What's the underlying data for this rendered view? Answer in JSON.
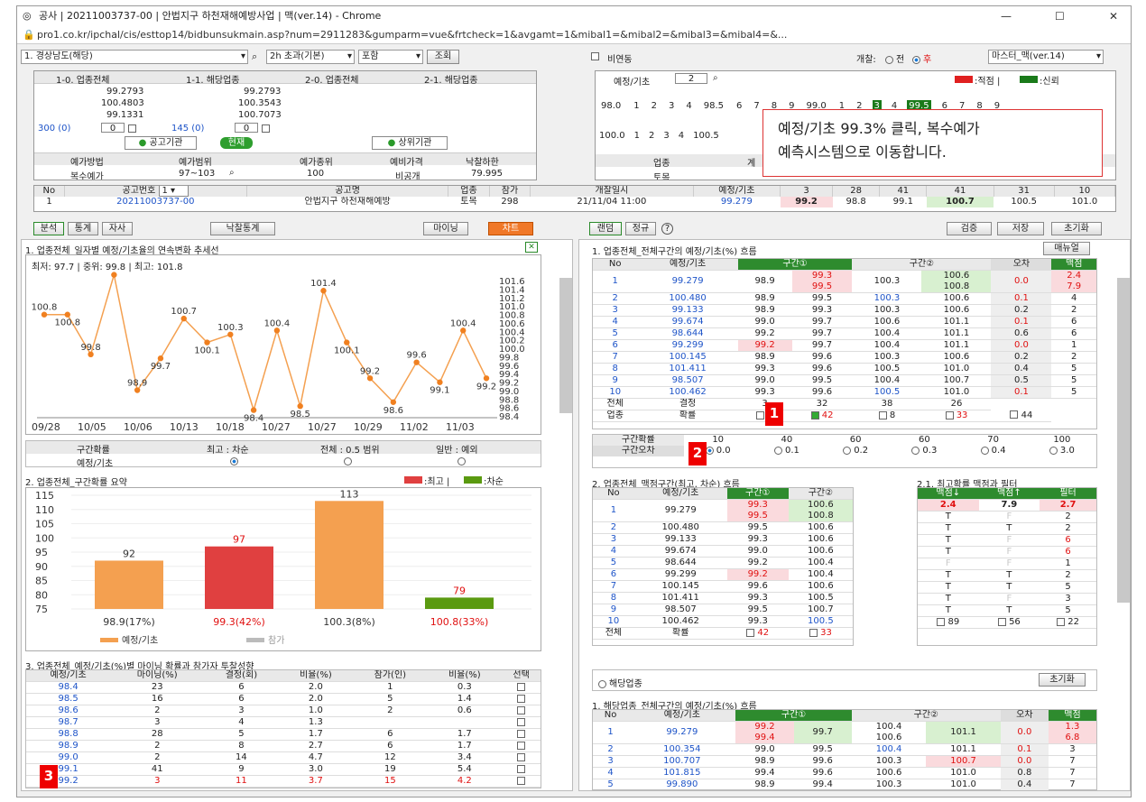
{
  "window": {
    "title": "공사 | 20211003737-00 | 안법지구 하천재해예방사업 | 맥(ver.14) - Chrome",
    "url": "pro1.co.kr/ipchal/cis/esttop14/bidbunsukmain.asp?num=2911283&gumparm=vue&frtcheck=1&avgamt=1&mibal1=&mibal2=&mibal3=&mibal4=&..."
  },
  "toolbar": {
    "region": "1. 경상남도(해당)",
    "period": "2h 초과(기본)",
    "type": "포함",
    "search": "조회",
    "nonlink": "비연동",
    "gaechal_label": "개찰:",
    "opt_all": "전",
    "opt_after": "후",
    "master": "마스터_맥(ver.14)"
  },
  "top_left": {
    "headers": [
      "1-0. 업종전체",
      "1-1. 해당업종",
      "2-0. 업종전체",
      "2-1. 해당업종"
    ],
    "col1": [
      "99.2793",
      "100.4803",
      "99.1331"
    ],
    "col2": [
      "99.2793",
      "100.3543",
      "100.7073"
    ],
    "cnt1": "300 (0)",
    "cnt2": "145 (0)",
    "in1": "0",
    "in2": "0",
    "btn_agency": "공고기관",
    "btn_now": "현재",
    "btn_upper": "상위기관"
  },
  "price_info": {
    "headers": [
      "예가방법",
      "예가범위",
      "예가종위",
      "예비가격",
      "낙찰하한"
    ],
    "values": [
      "복수예가",
      "97~103",
      "100",
      "비공개",
      "79.995"
    ]
  },
  "yejeong": {
    "label": "예정/기초",
    "val": "2",
    "legend1": ":적점 |",
    "legend2": ":신뢰",
    "row1": [
      "98.0",
      "1",
      "2",
      "3",
      "4",
      "98.5",
      "6",
      "7",
      "8",
      "9",
      "99.0",
      "1",
      "2",
      "3",
      "4",
      "99.5",
      "6",
      "7",
      "8",
      "9"
    ],
    "row2": [
      "100.0",
      "1",
      "2",
      "3",
      "4",
      "100.5"
    ],
    "biz_label": "업종",
    "biz_val": "토목",
    "gye": "계"
  },
  "callout": {
    "line1": "예정/기초 99.3% 클릭, 복수예가",
    "line2": "예측시스템으로 이동합니다."
  },
  "notice": {
    "headers": [
      "No",
      "공고번호",
      "공고명",
      "업종",
      "참가",
      "개찰일시",
      "예정/기초",
      "3",
      "28",
      "41",
      "41",
      "31",
      "10"
    ],
    "combo": "1",
    "row": [
      "1",
      "20211003737-00",
      "안법지구 하천재해예방",
      "토목",
      "298",
      "21/11/04 11:00",
      "99.279",
      "99.2",
      "98.8",
      "99.1",
      "100.7",
      "100.5",
      "101.0"
    ]
  },
  "left_tabs": {
    "t1": "분석",
    "t2": "통계",
    "t3": "자사",
    "t4": "낙찰통계",
    "t5": "마이닝",
    "t6": "차트"
  },
  "right_tabs": {
    "t1": "랜덤",
    "t2": "정규",
    "t3": "?",
    "b1": "검증",
    "b2": "저장",
    "b3": "초기화"
  },
  "chart1": {
    "title": "1. 업종전체_일자별 예정/기초율의 연속변화 추세선",
    "stats": "최저: 97.7 | 중위: 99.8 | 최고: 101.8"
  },
  "chart_data": [
    {
      "type": "line",
      "title": "1. 업종전체_일자별 예정/기초율의 연속변화 추세선",
      "y": [
        100.8,
        100.8,
        99.8,
        101.8,
        98.9,
        99.7,
        100.7,
        100.1,
        100.3,
        98.4,
        100.4,
        98.5,
        101.4,
        100.1,
        99.2,
        98.6,
        99.6,
        99.1,
        100.4,
        99.2
      ],
      "point_labels": [
        "100.8",
        "100.8",
        "99.8",
        "",
        "98.9",
        "99.7",
        "100.7",
        "100.1",
        "100.3",
        "98.4",
        "100.4",
        "98.5",
        "101.4",
        "100.1",
        "99.2",
        "98.6",
        "99.6",
        "99.1",
        "100.4",
        "99.2"
      ],
      "xticks": [
        "09/28",
        "10/05",
        "10/06",
        "10/13",
        "10/18",
        "10/27",
        "10/27",
        "10/29",
        "11/02",
        "11/03"
      ],
      "yticks": [
        "101.6",
        "101.4",
        "101.2",
        "101.0",
        "100.8",
        "100.6",
        "100.4",
        "100.2",
        "100.0",
        "99.8",
        "99.6",
        "99.4",
        "99.2",
        "99.0",
        "98.8",
        "98.6",
        "98.4"
      ],
      "ylim": [
        98.3,
        101.7
      ]
    },
    {
      "type": "bar",
      "title": "2. 업종전체_구간확률 요약",
      "categories": [
        "98.9(17%)",
        "99.3(42%)",
        "100.3(8%)",
        "100.8(33%)"
      ],
      "values": [
        92,
        97,
        113,
        79
      ],
      "colors": [
        "#f4a050",
        "#e04040",
        "#f4a050",
        "#5a9a10"
      ],
      "yticks": [
        "115",
        "110",
        "105",
        "100",
        "95",
        "90",
        "85",
        "80",
        "75"
      ],
      "ylim": [
        75,
        115
      ],
      "legend_top": [
        ":최고 |",
        ":차순"
      ],
      "legend_bottom": [
        "예정/기초",
        "참가"
      ]
    }
  ],
  "prob_row": {
    "h1": "구간확률",
    "h2": "최고 : 차순",
    "h3": "전체 : 0.5 범위",
    "h4": "일반 : 예외",
    "label": "예정/기초"
  },
  "table3": {
    "title": "3. 업종전체_예정/기초(%)별 마이닝 확률과 참가자 투찰성향",
    "headers": [
      "예정/기초",
      "마이닝(%)",
      "결정(회)",
      "비율(%)",
      "참가(인)",
      "비율(%)",
      "선택"
    ],
    "rows": [
      [
        "98.4",
        "23",
        "6",
        "2.0",
        "1",
        "0.3"
      ],
      [
        "98.5",
        "16",
        "6",
        "2.0",
        "5",
        "1.4"
      ],
      [
        "98.6",
        "2",
        "3",
        "1.0",
        "2",
        "0.6"
      ],
      [
        "98.7",
        "3",
        "4",
        "1.3",
        "",
        ""
      ],
      [
        "98.8",
        "28",
        "5",
        "1.7",
        "6",
        "1.7"
      ],
      [
        "98.9",
        "2",
        "8",
        "2.7",
        "6",
        "1.7"
      ],
      [
        "99.0",
        "2",
        "14",
        "4.7",
        "12",
        "3.4"
      ],
      [
        "99.1",
        "41",
        "9",
        "3.0",
        "19",
        "5.4"
      ],
      [
        "99.2",
        "3",
        "11",
        "3.7",
        "15",
        "4.2"
      ]
    ]
  },
  "rtable1": {
    "title": "1. 업종전체_전체구간의 예정/기초(%) 흐름",
    "menu": "매뉴얼",
    "headers": [
      "No",
      "예정/기초",
      "구간①",
      "구간②",
      "오차",
      "맥점"
    ],
    "rows": [
      [
        "1",
        "99.279",
        "98.9",
        "99.3\n99.5",
        "100.3",
        "100.6\n100.8",
        "0.0",
        "2.4\n7.9"
      ],
      [
        "2",
        "100.480",
        "98.9",
        "99.5",
        "100.3",
        "100.6",
        "0.1",
        "4"
      ],
      [
        "3",
        "99.133",
        "98.9",
        "99.3",
        "100.3",
        "100.6",
        "0.2",
        "2"
      ],
      [
        "4",
        "99.674",
        "99.0",
        "99.7",
        "100.6",
        "101.1",
        "0.1",
        "6"
      ],
      [
        "5",
        "98.644",
        "99.2",
        "99.7",
        "100.4",
        "101.1",
        "0.6",
        "6"
      ],
      [
        "6",
        "99.299",
        "99.2",
        "99.7",
        "100.4",
        "101.1",
        "0.0",
        "1"
      ],
      [
        "7",
        "100.145",
        "98.9",
        "99.6",
        "100.3",
        "100.6",
        "0.2",
        "2"
      ],
      [
        "8",
        "101.411",
        "99.3",
        "99.6",
        "100.5",
        "101.0",
        "0.4",
        "5"
      ],
      [
        "9",
        "98.507",
        "99.0",
        "99.5",
        "100.4",
        "100.7",
        "0.5",
        "5"
      ],
      [
        "10",
        "100.462",
        "99.3",
        "99.6",
        "100.5",
        "101.0",
        "0.1",
        "5"
      ]
    ],
    "total1": [
      "전체",
      "결정",
      "3",
      "32",
      "38",
      "26"
    ],
    "total2": [
      "업종",
      "확률",
      "1",
      "42",
      "8",
      "33",
      "44"
    ]
  },
  "gugan": {
    "label1": "구간확률",
    "vals": [
      "10",
      "40",
      "60",
      "60",
      "70",
      "100"
    ],
    "label2": "구간오차",
    "opts": [
      "0.0",
      "0.1",
      "0.2",
      "0.3",
      "0.4",
      "3.0"
    ]
  },
  "rtable2": {
    "title": "2. 업종전체_맥점구간(최고, 차순) 흐름",
    "headers": [
      "No",
      "예정/기초",
      "구간①",
      "구간②"
    ],
    "rows": [
      [
        "1",
        "99.279",
        "99.3\n99.5",
        "100.6\n100.8"
      ],
      [
        "2",
        "100.480",
        "99.5",
        "100.6"
      ],
      [
        "3",
        "99.133",
        "99.3",
        "100.6"
      ],
      [
        "4",
        "99.674",
        "99.0",
        "100.6"
      ],
      [
        "5",
        "98.644",
        "99.2",
        "100.4"
      ],
      [
        "6",
        "99.299",
        "99.2",
        "100.4"
      ],
      [
        "7",
        "100.145",
        "99.6",
        "100.6"
      ],
      [
        "8",
        "101.411",
        "99.3",
        "100.5"
      ],
      [
        "9",
        "98.507",
        "99.5",
        "100.7"
      ],
      [
        "10",
        "100.462",
        "99.3",
        "100.5"
      ]
    ],
    "total": [
      "전체",
      "확률",
      "42",
      "33"
    ]
  },
  "rtable21": {
    "title": "2.1. 최고확률 맥점과 필터",
    "headers": [
      "맥점↓",
      "맥점↑",
      "필터"
    ],
    "rows": [
      [
        "2.4",
        "7.9",
        "2.7"
      ],
      [
        "T",
        "F",
        "2"
      ],
      [
        "T",
        "T",
        "2"
      ],
      [
        "T",
        "F",
        "6"
      ],
      [
        "T",
        "F",
        "6"
      ],
      [
        "F",
        "F",
        "1"
      ],
      [
        "T",
        "T",
        "2"
      ],
      [
        "T",
        "T",
        "5"
      ],
      [
        "T",
        "F",
        "3"
      ],
      [
        "T",
        "T",
        "5"
      ]
    ],
    "total": [
      "89",
      "56",
      "22"
    ]
  },
  "rtable3": {
    "radio": "해당업종",
    "reset": "초기화",
    "title": "1. 해당업종_전체구간의 예정/기초(%) 흐름",
    "headers": [
      "No",
      "예정/기초",
      "구간①",
      "구간②",
      "오차",
      "맥점"
    ],
    "rows": [
      [
        "1",
        "99.279",
        "99.2\n99.4",
        "99.7",
        "100.4\n100.6",
        "101.1",
        "0.0",
        "1.3\n6.8"
      ],
      [
        "2",
        "100.354",
        "99.0",
        "99.5",
        "100.4",
        "101.1",
        "0.1",
        "3"
      ],
      [
        "3",
        "100.707",
        "98.9",
        "99.6",
        "100.3",
        "100.7",
        "0.0",
        "7"
      ],
      [
        "4",
        "101.815",
        "99.4",
        "99.6",
        "100.6",
        "101.0",
        "0.8",
        "7"
      ],
      [
        "5",
        "99.890",
        "98.9",
        "99.4",
        "100.3",
        "101.0",
        "0.4",
        "7"
      ]
    ]
  },
  "badges": [
    "1",
    "2",
    "3"
  ]
}
